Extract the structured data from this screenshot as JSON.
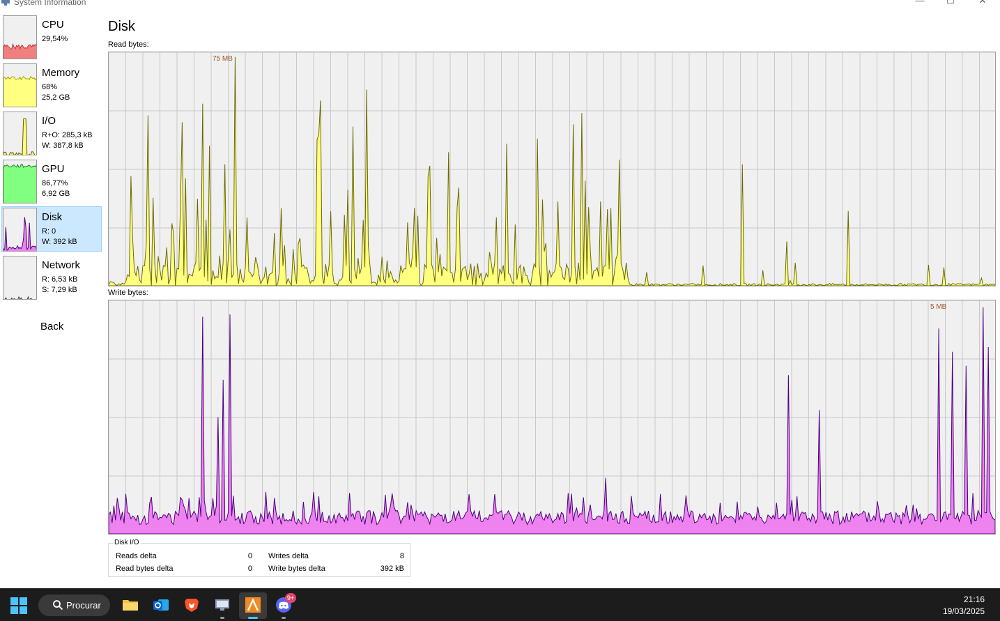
{
  "window": {
    "title": "System Information",
    "controls": {
      "minimize": "—",
      "maximize": "☐",
      "close": "✕"
    }
  },
  "sidebar": {
    "items": [
      {
        "title": "CPU",
        "line1": "29,54%",
        "line2": "",
        "fill": "#f08080",
        "stroke": "#c83232",
        "level": 0.3
      },
      {
        "title": "Memory",
        "line1": "68%",
        "line2": "25,2 GB",
        "fill": "#ffff80",
        "stroke": "#a0a000",
        "level": 0.68
      },
      {
        "title": "I/O",
        "line1": "R+O: 285,3 kB",
        "line2": "W: 387,8 kB",
        "fill": "#ffff80",
        "stroke": "#606000",
        "level": 0.05
      },
      {
        "title": "GPU",
        "line1": "86,77%",
        "line2": "6,92 GB",
        "fill": "#80ff80",
        "stroke": "#208020",
        "level": 0.87
      },
      {
        "title": "Disk",
        "line1": "R: 0",
        "line2": "W: 392 kB",
        "fill": "#ee82ee",
        "stroke": "#4b0082",
        "level": 0.1,
        "selected": true
      },
      {
        "title": "Network",
        "line1": "R: 6,53 kB",
        "line2": "S: 7,29 kB",
        "fill": "#c0c0c0",
        "stroke": "#404040",
        "level": 0.02
      }
    ],
    "back_label": "Back"
  },
  "main": {
    "title": "Disk",
    "read_label": "Read bytes:",
    "write_label": "Write bytes:",
    "read_peak": "75 MB",
    "write_peak": "5 MB",
    "read_colors": {
      "fill": "#ffff80",
      "stroke": "#6b6b00"
    },
    "write_colors": {
      "fill": "#ee82ee",
      "stroke": "#4b0082"
    }
  },
  "disk_io": {
    "legend": "Disk I/O",
    "reads_delta_label": "Reads delta",
    "reads_delta_value": "0",
    "read_bytes_delta_label": "Read bytes delta",
    "read_bytes_delta_value": "0",
    "writes_delta_label": "Writes delta",
    "writes_delta_value": "8",
    "write_bytes_delta_label": "Write bytes delta",
    "write_bytes_delta_value": "392 kB"
  },
  "taskbar": {
    "search_label": "Procurar",
    "apps": [
      {
        "name": "file-explorer",
        "color": "#f5c242"
      },
      {
        "name": "outlook",
        "color": "#0a64c8"
      },
      {
        "name": "brave",
        "color": "#fb542b"
      },
      {
        "name": "system-info",
        "color": "#8aa0b8"
      },
      {
        "name": "active-app",
        "color": "#f08a24"
      },
      {
        "name": "discord",
        "color": "#5865f2",
        "badge": "9+"
      }
    ],
    "time": "21:16",
    "date": "19/03/2025"
  }
}
